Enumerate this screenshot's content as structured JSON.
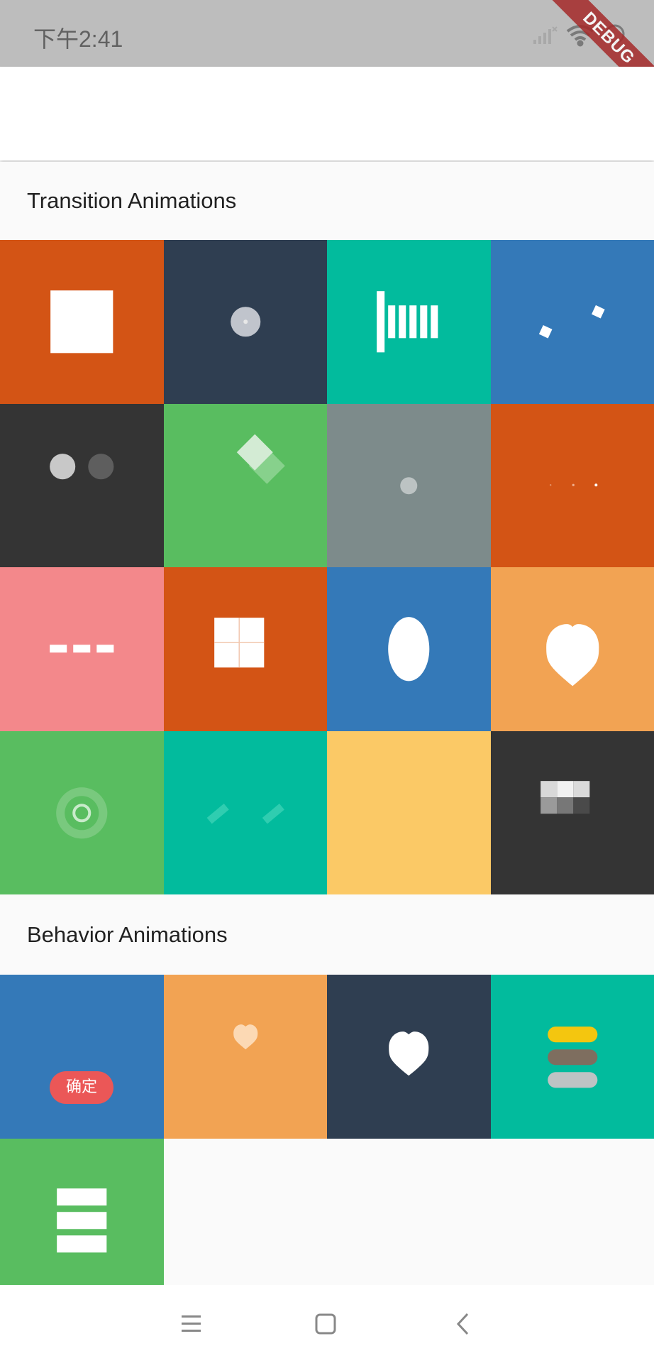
{
  "status_bar": {
    "time": "下午2:41"
  },
  "debug_banner": {
    "label": "DEBUG"
  },
  "sections": {
    "transition": {
      "title": "Transition Animations"
    },
    "behavior": {
      "title": "Behavior Animations"
    }
  },
  "transition_tiles": [
    {
      "color": "#d35415"
    },
    {
      "color": "#2f3e51"
    },
    {
      "color": "#02bb9d"
    },
    {
      "color": "#3479b8"
    },
    {
      "color": "#343434"
    },
    {
      "color": "#59bd60"
    },
    {
      "color": "#7d8b8b"
    },
    {
      "color": "#d35415"
    },
    {
      "color": "#f3888b"
    },
    {
      "color": "#d35415"
    },
    {
      "color": "#3479b8"
    },
    {
      "color": "#f2a353"
    },
    {
      "color": "#59bd60"
    },
    {
      "color": "#02bb9d"
    },
    {
      "color": "#fbc966"
    },
    {
      "color": "#343434"
    }
  ],
  "behavior_tiles": [
    {
      "color": "#3479b8",
      "button_label": "确定"
    },
    {
      "color": "#f2a353"
    },
    {
      "color": "#2f3e51"
    },
    {
      "color": "#02bb9d"
    },
    {
      "color": "#59bd60"
    }
  ],
  "colors": {
    "status_bar": "#bdbdbd",
    "app_bar": "#ffffff",
    "background": "#fafafa",
    "debug_ribbon": "#a52a2a",
    "confirm_button": "#eb5757"
  }
}
